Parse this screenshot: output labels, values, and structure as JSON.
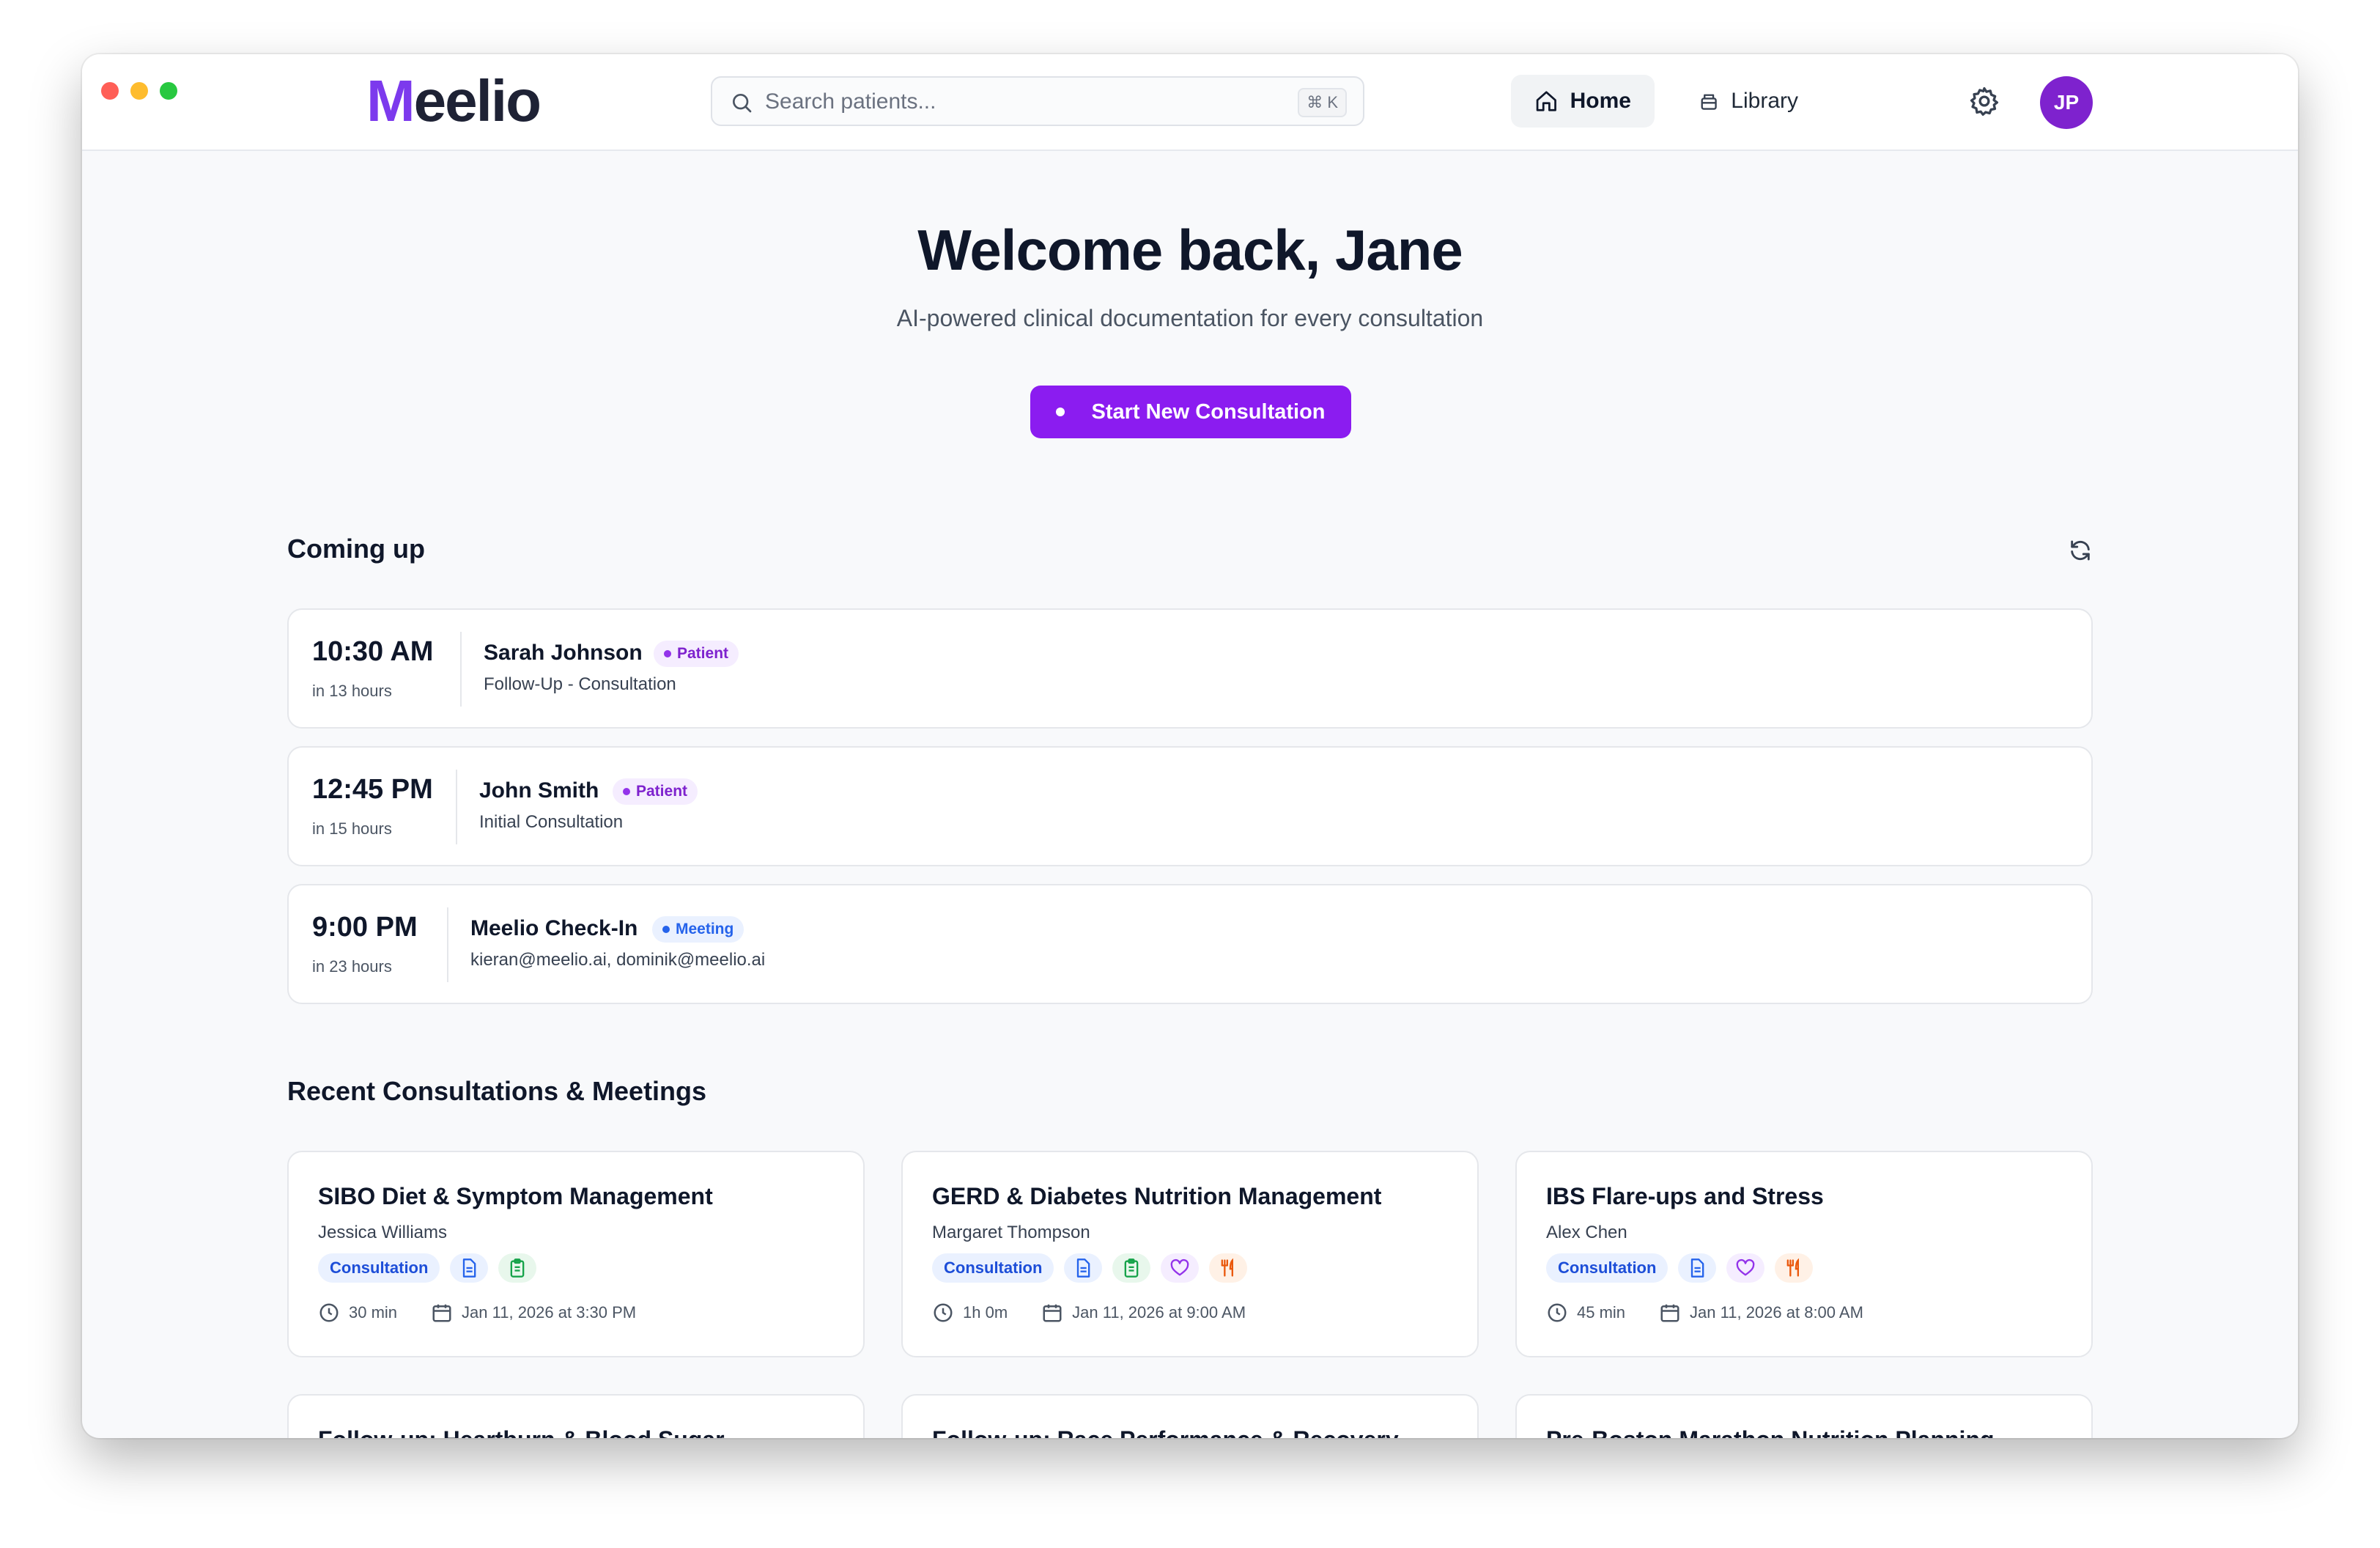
{
  "app": {
    "brand": "eelio",
    "brand_mark": "M"
  },
  "search": {
    "placeholder": "Search patients...",
    "shortcut": "⌘ K"
  },
  "nav": {
    "home": "Home",
    "library": "Library"
  },
  "user": {
    "initials": "JP"
  },
  "hero": {
    "title": "Welcome back, Jane",
    "subtitle": "AI-powered clinical documentation for every consultation",
    "cta": "Start New Consultation"
  },
  "upcoming": {
    "title": "Coming up",
    "items": [
      {
        "time": "10:30 AM",
        "relative": "in 13 hours",
        "name": "Sarah Johnson",
        "tag": "Patient",
        "detail": "Follow-Up - Consultation"
      },
      {
        "time": "12:45 PM",
        "relative": "in 15 hours",
        "name": "John Smith",
        "tag": "Patient",
        "detail": "Initial Consultation"
      },
      {
        "time": "9:00 PM",
        "relative": "in 23 hours",
        "name": "Meelio Check-In",
        "tag": "Meeting",
        "detail": "kieran@meelio.ai, dominik@meelio.ai"
      }
    ]
  },
  "recent": {
    "title": "Recent Consultations & Meetings",
    "cards": [
      {
        "title": "SIBO Diet & Symptom Management",
        "patient": "Jessica Williams",
        "type": "Consultation",
        "duration": "30 min",
        "date": "Jan 11, 2026 at 3:30 PM"
      },
      {
        "title": "GERD & Diabetes Nutrition Management",
        "patient": "Margaret Thompson",
        "type": "Consultation",
        "duration": "1h 0m",
        "date": "Jan 11, 2026 at 9:00 AM"
      },
      {
        "title": "IBS Flare-ups and Stress",
        "patient": "Alex Chen",
        "type": "Consultation",
        "duration": "45 min",
        "date": "Jan 11, 2026 at 8:00 AM"
      }
    ],
    "more": [
      {
        "title": "Follow-up: Heartburn & Blood Sugar"
      },
      {
        "title": "Follow-up: Race Performance & Recovery"
      },
      {
        "title": "Pre-Boston Marathon Nutrition Planning"
      }
    ]
  },
  "colors": {
    "accent": "#8b1cf0",
    "avatar": "#7e22ce",
    "patient_tag": "#7e22ce",
    "meeting_tag": "#2563eb"
  }
}
